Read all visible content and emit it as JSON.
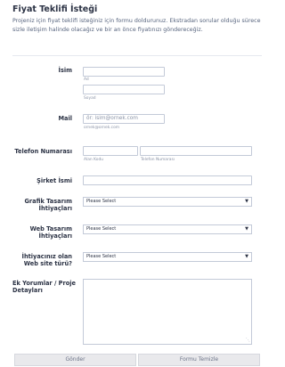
{
  "form": {
    "title": "Fiyat Teklifi İsteği",
    "description": "Projeniz için fiyat teklifi isteğiniz için formu doldurunuz. Ekstradan sorular olduğu sürece sizle iletişim halinde olacağız ve bir an önce fiyatınızı göndereceğiz."
  },
  "name": {
    "label": "İsim",
    "first_sublabel": "Ad",
    "last_sublabel": "Soyad",
    "first_value": "",
    "last_value": ""
  },
  "email": {
    "label": "Mail",
    "placeholder": "ör: isim@ornek.com",
    "sublabel": "ornek@ornek.com"
  },
  "phone": {
    "label": "Telefon Numarası",
    "area_sublabel": "Alan Kodu",
    "number_sublabel": "Telefon Numarası"
  },
  "company": {
    "label": "Şirket İsmi"
  },
  "graphic_design": {
    "label": "Grafik Tasarım İhtiyaçları",
    "selected": "Please Select"
  },
  "web_design": {
    "label": "Web Tasarım İhtiyaçları",
    "selected": "Please Select"
  },
  "website_type": {
    "label": "İhtiyacınız olan Web site türü?",
    "selected": "Please Select"
  },
  "comments": {
    "label": "Ek Yorumlar / Proje Detayları"
  },
  "buttons": {
    "submit": "Gönder",
    "clear": "Formu Temizle"
  }
}
